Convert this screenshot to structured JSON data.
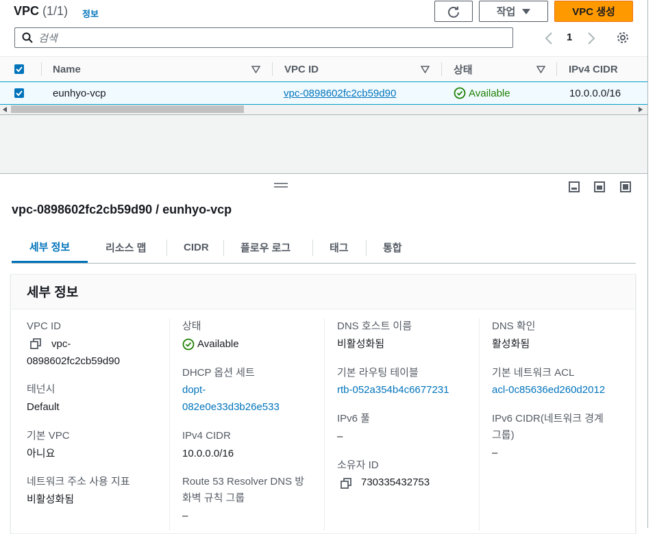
{
  "header": {
    "title": "VPC",
    "count": "(1/1)",
    "info_label": "정보",
    "actions_label": "작업",
    "create_label": "VPC 생성",
    "search_placeholder": "검색",
    "page_number": "1"
  },
  "table": {
    "columns": [
      "Name",
      "VPC ID",
      "상태",
      "IPv4 CIDR"
    ],
    "rows": [
      {
        "name": "eunhyo-vcp",
        "vpc_id": "vpc-0898602fc2cb59d90",
        "state": "Available",
        "ipv4_cidr": "10.0.0.0/16",
        "selected": true
      }
    ]
  },
  "detail": {
    "title": "vpc-0898602fc2cb59d90 / eunhyo-vcp",
    "tabs": [
      "세부 정보",
      "리소스 맵",
      "CIDR",
      "플로우 로그",
      "태그",
      "통합"
    ],
    "active_tab": "세부 정보",
    "panel_title": "세부 정보",
    "fields": {
      "vpc_id_label": "VPC ID",
      "vpc_id_line1": "vpc-",
      "vpc_id_line2": "0898602fc2cb59d90",
      "tenancy_label": "테넌시",
      "tenancy_value": "Default",
      "default_vpc_label": "기본 VPC",
      "default_vpc_value": "아니요",
      "net_addr_label": "네트워크 주소 사용 지표",
      "net_addr_value": "비활성화됨",
      "state_label": "상태",
      "state_value": "Available",
      "dhcp_label": "DHCP 옵션 세트",
      "dhcp_line1": "dopt-",
      "dhcp_line2": "082e0e33d3b26e533",
      "ipv4_label": "IPv4 CIDR",
      "ipv4_value": "10.0.0.0/16",
      "r53_label_line1": "Route 53 Resolver DNS 방",
      "r53_label_line2": "화벽 규칙 그룹",
      "r53_value": "–",
      "dns_host_label": "DNS 호스트 이름",
      "dns_host_value": "비활성화됨",
      "main_rtb_label": "기본 라우팅 테이블",
      "main_rtb_value": "rtb-052a354b4c6677231",
      "ipv6_pool_label": "IPv6 풀",
      "ipv6_pool_value": "–",
      "owner_label": "소유자 ID",
      "owner_value": "730335432753",
      "dns_res_label": "DNS 확인",
      "dns_res_value": "활성화됨",
      "main_acl_label": "기본 네트워크 ACL",
      "main_acl_value": "acl-0c85636ed260d2012",
      "ipv6_cidr_label_line1": "IPv6 CIDR(네트워크 경계",
      "ipv6_cidr_label_line2": "그룹)",
      "ipv6_cidr_value": "–"
    }
  },
  "colors": {
    "accent": "#0073bb",
    "primary_button": "#ff9900",
    "success": "#1d8102"
  }
}
